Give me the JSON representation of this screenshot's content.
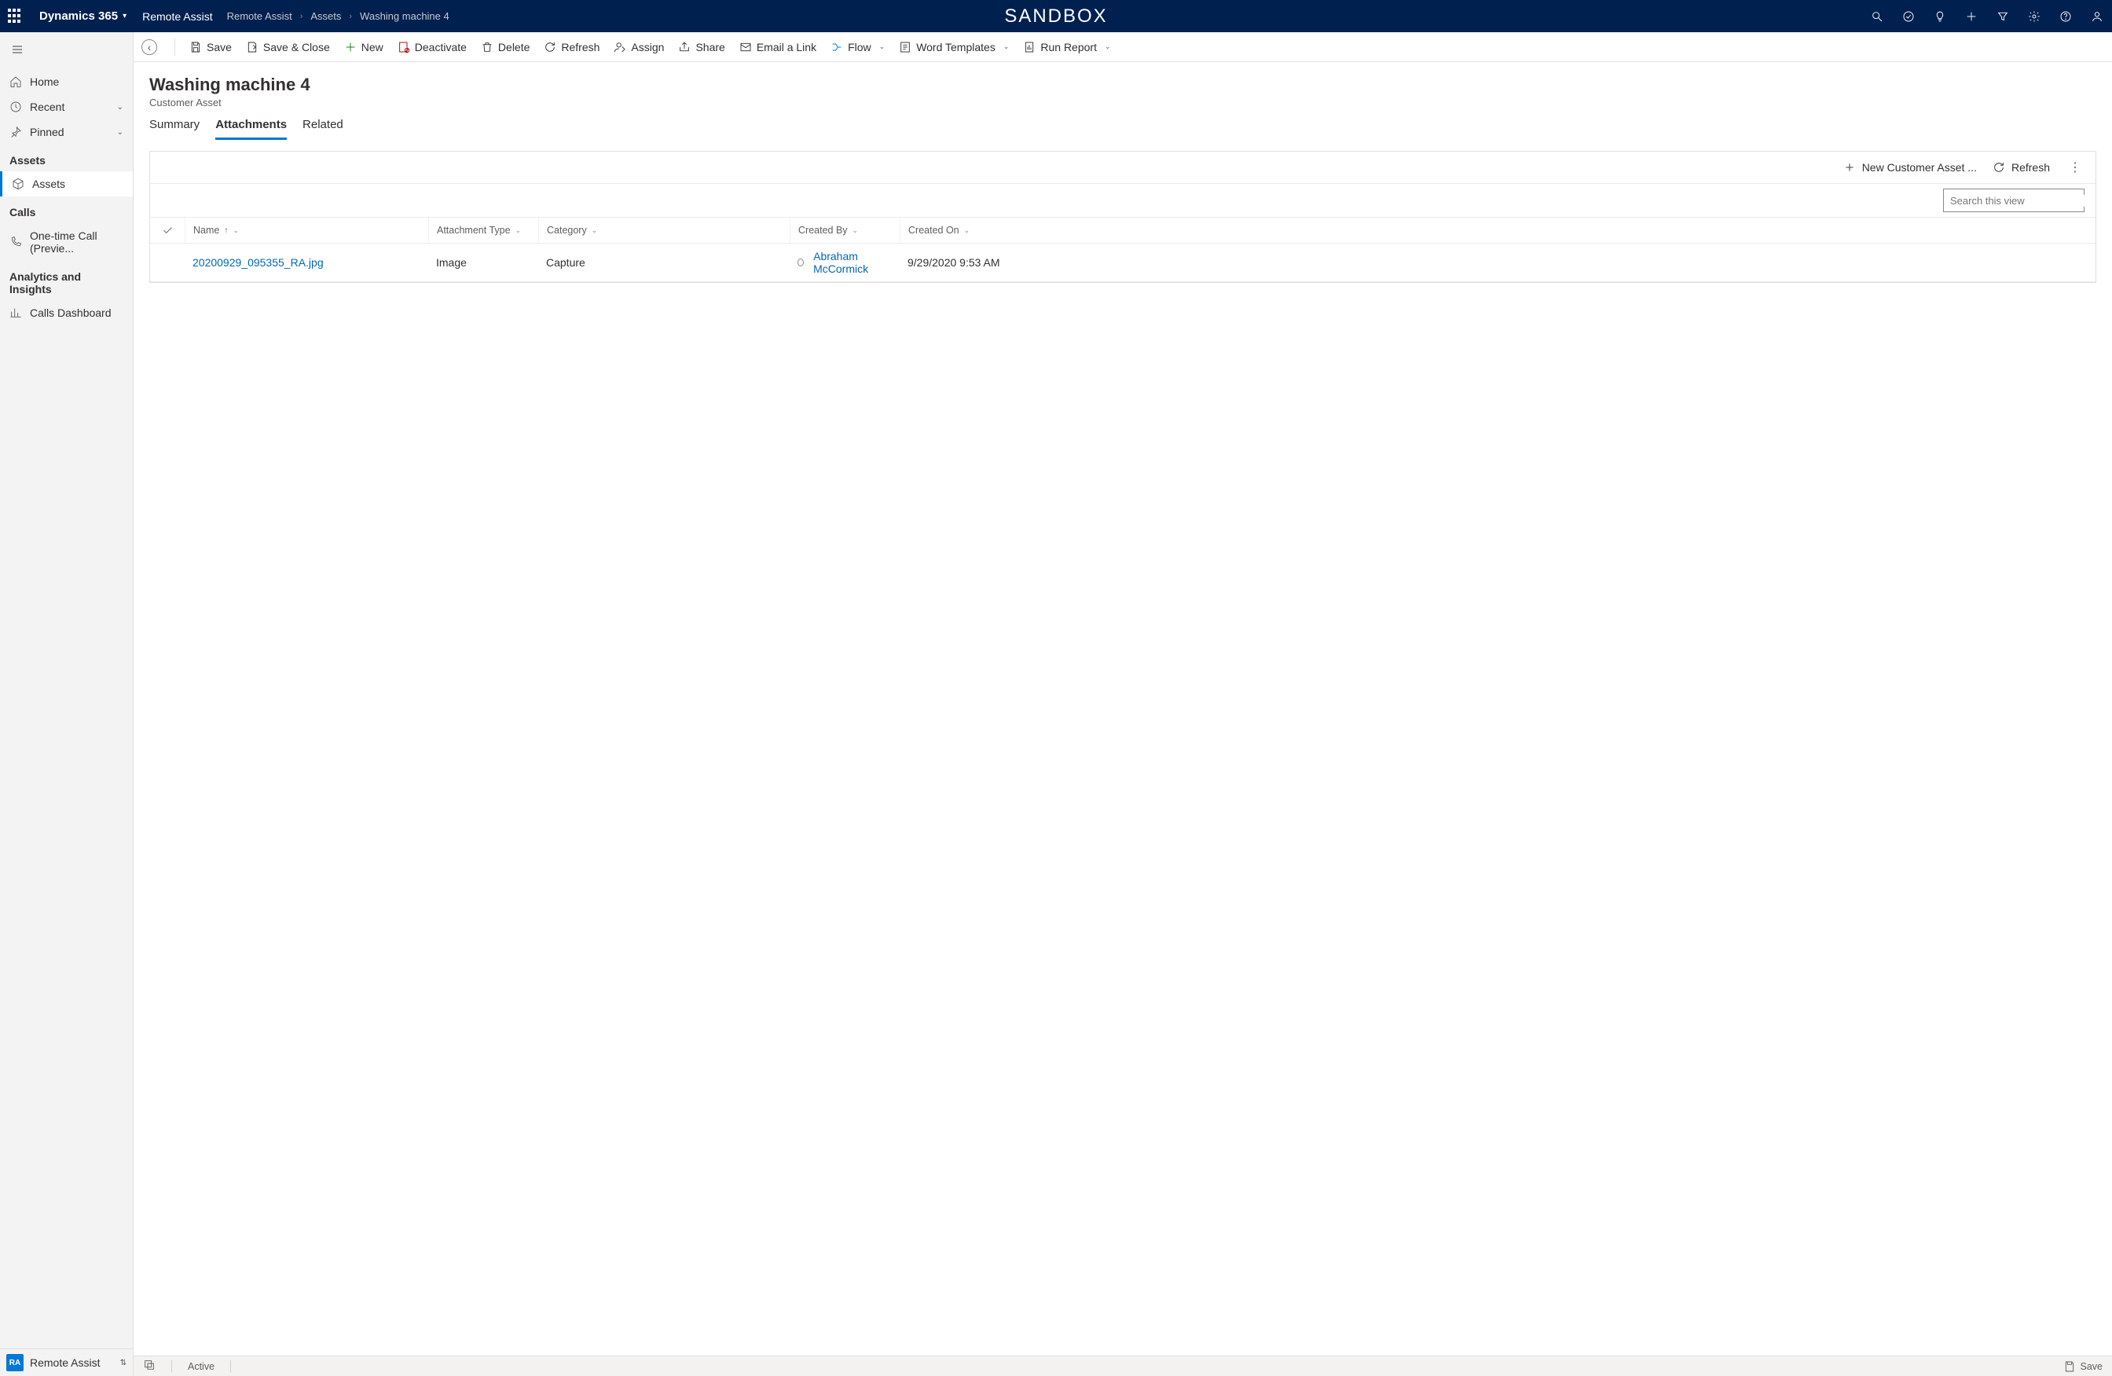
{
  "topbar": {
    "brand": "Dynamics 365",
    "app_name": "Remote Assist",
    "sandbox": "SANDBOX",
    "breadcrumbs": [
      "Remote Assist",
      "Assets",
      "Washing machine 4"
    ]
  },
  "leftnav": {
    "home": "Home",
    "recent": "Recent",
    "pinned": "Pinned",
    "group_assets": "Assets",
    "assets": "Assets",
    "group_calls": "Calls",
    "one_time_call": "One-time Call (Previe...",
    "group_analytics": "Analytics and Insights",
    "calls_dashboard": "Calls Dashboard",
    "footer_badge": "RA",
    "footer_label": "Remote Assist"
  },
  "cmd": {
    "save": "Save",
    "save_close": "Save & Close",
    "new": "New",
    "deactivate": "Deactivate",
    "delete": "Delete",
    "refresh": "Refresh",
    "assign": "Assign",
    "share": "Share",
    "email_link": "Email a Link",
    "flow": "Flow",
    "word_templates": "Word Templates",
    "run_report": "Run Report"
  },
  "record": {
    "title": "Washing machine  4",
    "subtitle": "Customer Asset"
  },
  "tabs": {
    "summary": "Summary",
    "attachments": "Attachments",
    "related": "Related"
  },
  "panel": {
    "new_btn": "New Customer Asset ...",
    "refresh_btn": "Refresh",
    "search_placeholder": "Search this view"
  },
  "grid": {
    "headers": {
      "name": "Name",
      "attachment_type": "Attachment Type",
      "category": "Category",
      "created_by": "Created By",
      "created_on": "Created On"
    },
    "rows": [
      {
        "name": "20200929_095355_RA.jpg",
        "attachment_type": "Image",
        "category": "Capture",
        "created_by": "Abraham McCormick",
        "created_on": "9/29/2020 9:53 AM"
      }
    ]
  },
  "status": {
    "state": "Active",
    "save": "Save"
  }
}
